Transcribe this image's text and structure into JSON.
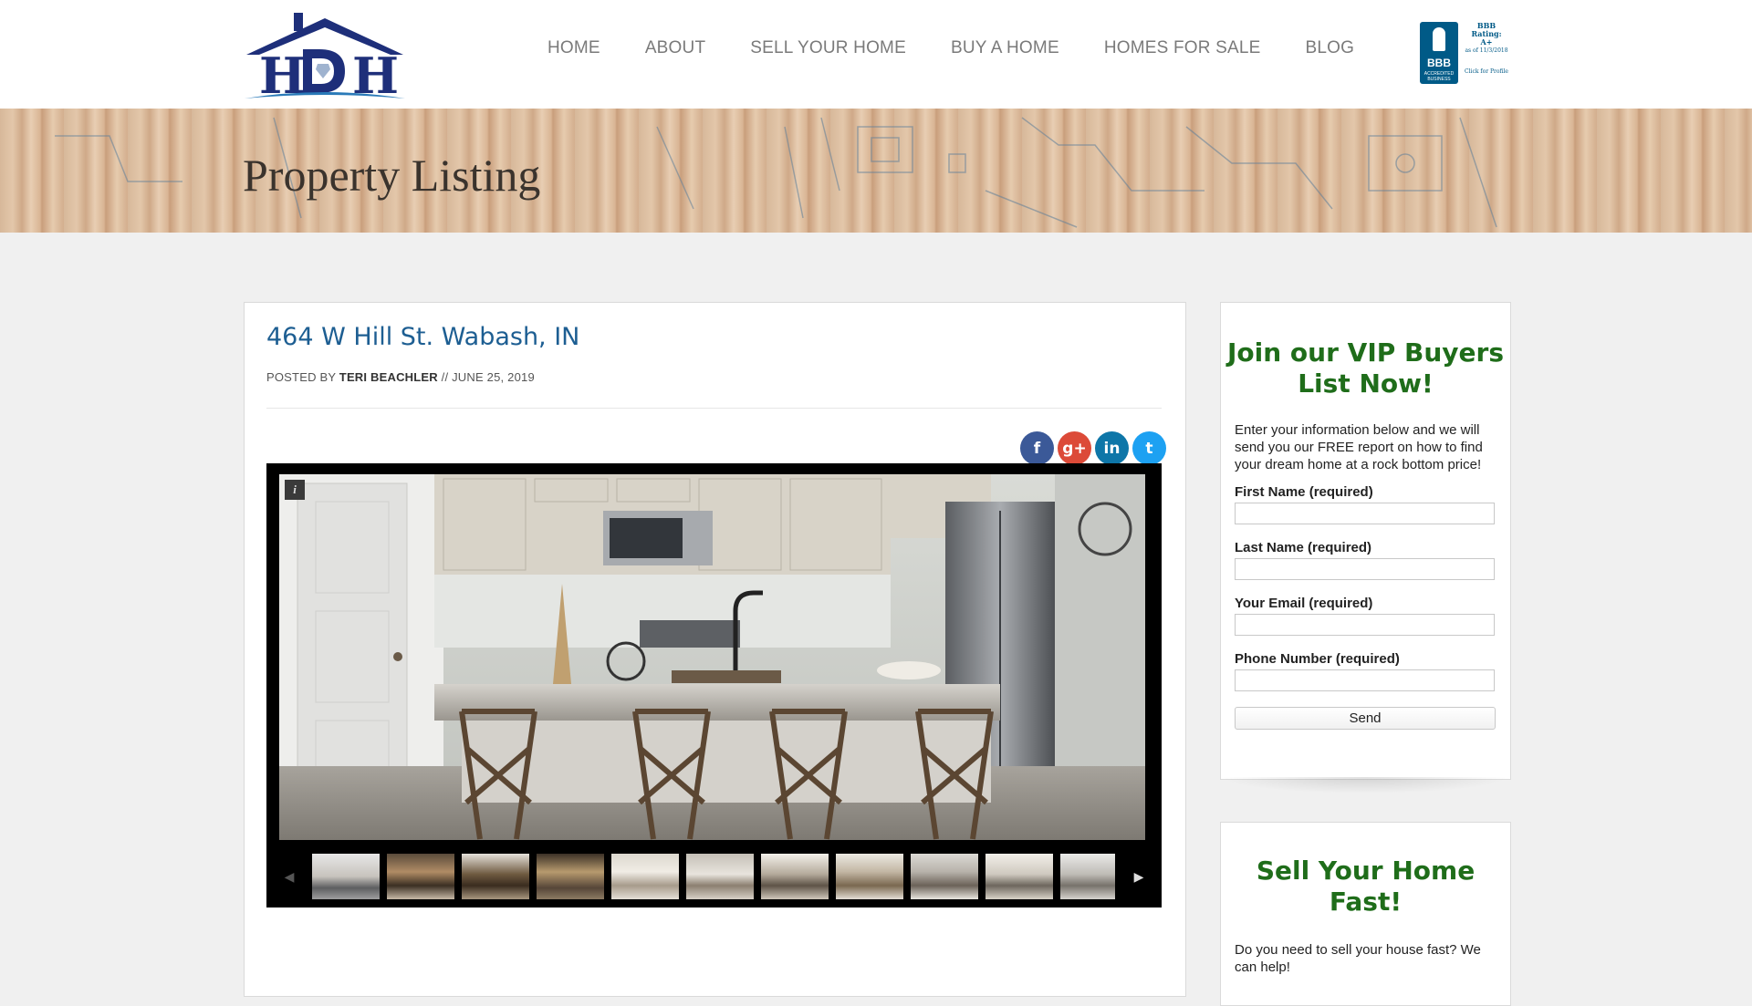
{
  "brand": {
    "logo_text": "HDH",
    "logo_alt": "house-logo"
  },
  "nav": {
    "items": [
      {
        "label": "HOME"
      },
      {
        "label": "ABOUT"
      },
      {
        "label": "SELL YOUR HOME"
      },
      {
        "label": "BUY A HOME"
      },
      {
        "label": "HOMES FOR SALE"
      },
      {
        "label": "BLOG"
      }
    ]
  },
  "bbb": {
    "seal_word": "BBB",
    "seal_sub": "ACCREDITED BUSINESS",
    "rating_line1": "BBB",
    "rating_line2": "Rating:",
    "rating_line3": "A+",
    "as_of": "as of 11/3/2018",
    "click": "Click for Profile"
  },
  "banner": {
    "title": "Property Listing"
  },
  "post": {
    "title": "464 W Hill St. Wabash, IN",
    "posted_by_label": "POSTED BY",
    "author": "TERI BEACHLER",
    "separator": "//",
    "date": "JUNE 25, 2019"
  },
  "share": {
    "facebook": "f",
    "google": "g+",
    "linkedin": "in",
    "twitter": "t"
  },
  "gallery": {
    "info_label": "i",
    "prev_arrow": "◀",
    "next_arrow": "▶",
    "thumb_count": 11
  },
  "vip_widget": {
    "title": "Join our VIP Buyers List Now!",
    "description": "Enter your information below and we will send you our FREE report on how to find your dream home at a rock bottom price!",
    "fields": [
      {
        "label": "First Name (required)",
        "value": "",
        "placeholder": ""
      },
      {
        "label": "Last Name (required)",
        "value": "",
        "placeholder": ""
      },
      {
        "label": "Your Email (required)",
        "value": "",
        "placeholder": ""
      },
      {
        "label": "Phone Number (required)",
        "value": "",
        "placeholder": ""
      }
    ],
    "send_label": "Send"
  },
  "sell_widget": {
    "title": "Sell Your Home Fast!",
    "description": "Do you need to sell your house fast? We can help!"
  },
  "colors": {
    "heading_blue": "#1d5e92",
    "widget_green": "#1f6d1a",
    "nav_gray": "#7a7a7a",
    "logo_navy": "#1e2f7a",
    "logo_blue": "#2a7ab8"
  }
}
